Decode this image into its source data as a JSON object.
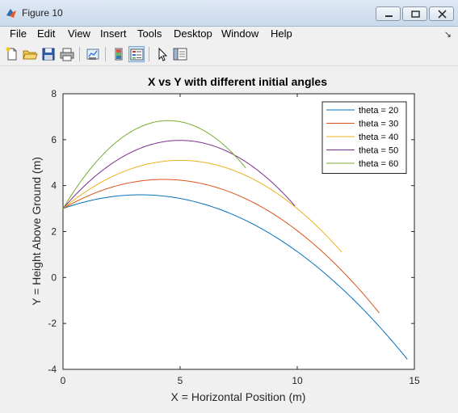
{
  "window": {
    "title": "Figure 10"
  },
  "menus": [
    "File",
    "Edit",
    "View",
    "Insert",
    "Tools",
    "Desktop",
    "Window",
    "Help"
  ],
  "toolbar_icons": [
    "new-figure-icon",
    "open-file-icon",
    "save-icon",
    "print-icon",
    "link-plot-icon",
    "insert-colorbar-icon",
    "insert-legend-icon",
    "edit-plot-icon",
    "property-inspector-icon"
  ],
  "chart_data": {
    "type": "line",
    "title": "X vs Y with different initial angles",
    "xlabel": "X = Horizontal Position (m)",
    "ylabel": "Y = Height Above Ground (m)",
    "xlim": [
      0,
      15
    ],
    "ylim": [
      -4,
      8
    ],
    "xticks": [
      0,
      5,
      10,
      15
    ],
    "yticks": [
      -4,
      -2,
      0,
      2,
      4,
      6,
      8
    ],
    "xtick_labels": [
      "0",
      "5",
      "10",
      "15"
    ],
    "ytick_labels": [
      "-4",
      "-2",
      "0",
      "2",
      "4",
      "6",
      "8"
    ],
    "legend_position": "top-right",
    "grid": false,
    "series": [
      {
        "name": "theta = 20",
        "color": "#0072bd",
        "y0": 3,
        "xpeak": 3.3,
        "ypeak": 3.6,
        "xend": 14.7
      },
      {
        "name": "theta = 30",
        "color": "#d95319",
        "y0": 3,
        "xpeak": 4.3,
        "ypeak": 4.27,
        "xend": 13.5
      },
      {
        "name": "theta = 40",
        "color": "#edb120",
        "y0": 3,
        "xpeak": 5.0,
        "ypeak": 5.1,
        "xend": 11.9
      },
      {
        "name": "theta = 50",
        "color": "#7e2f8e",
        "y0": 3,
        "xpeak": 5.0,
        "ypeak": 5.97,
        "xend": 9.9
      },
      {
        "name": "theta = 60",
        "color": "#77ac30",
        "y0": 3,
        "xpeak": 4.5,
        "ypeak": 6.83,
        "xend": 7.8
      }
    ]
  }
}
